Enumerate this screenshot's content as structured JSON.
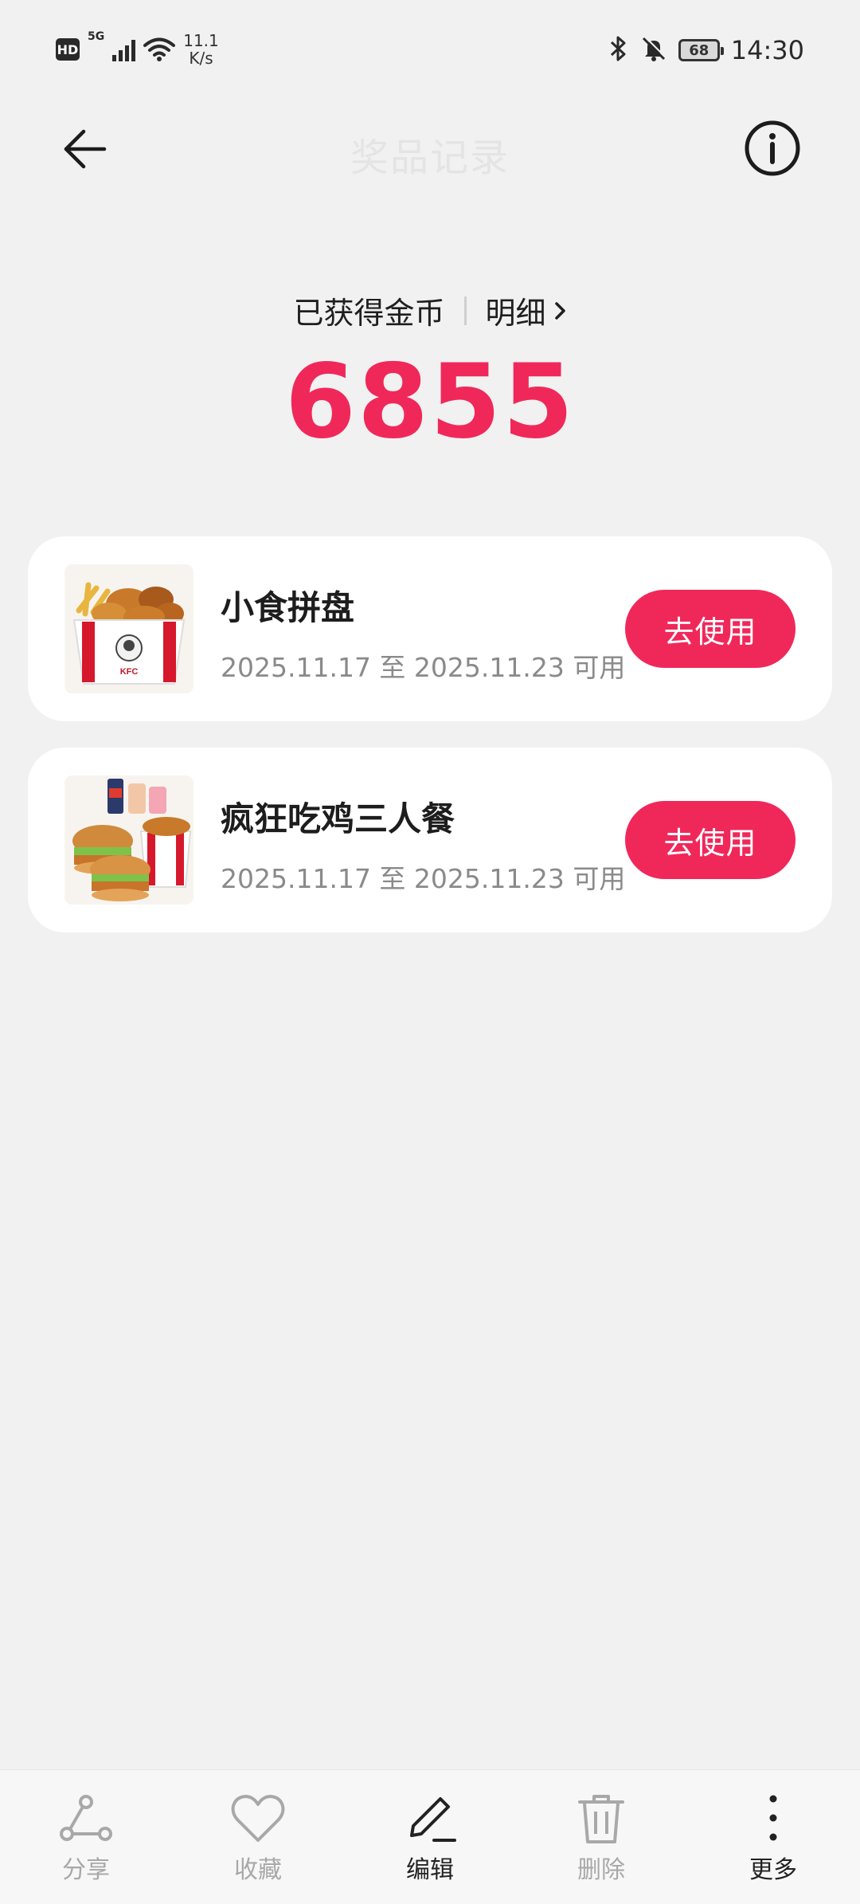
{
  "status_bar": {
    "hd": "HD",
    "network": "5G",
    "speed_value": "11.1",
    "speed_unit": "K/s",
    "battery": "68",
    "time": "14:30"
  },
  "header": {
    "title": "奖品记录",
    "back_icon": "arrow-left-icon",
    "info_icon": "info-circle-icon"
  },
  "coins": {
    "label": "已获得金币",
    "detail_label": "明细",
    "value": "6855"
  },
  "prizes": [
    {
      "title": "小食拼盘",
      "validity": "2025.11.17 至 2025.11.23 可用",
      "button": "去使用"
    },
    {
      "title": "疯狂吃鸡三人餐",
      "validity": "2025.11.17 至 2025.11.23 可用",
      "button": "去使用"
    }
  ],
  "bottom_bar": [
    {
      "label": "分享",
      "icon": "share-icon"
    },
    {
      "label": "收藏",
      "icon": "heart-icon"
    },
    {
      "label": "编辑",
      "icon": "pencil-icon"
    },
    {
      "label": "删除",
      "icon": "trash-icon"
    },
    {
      "label": "更多",
      "icon": "more-vertical-icon"
    }
  ],
  "colors": {
    "accent": "#f0285a",
    "background": "#f1f1f1",
    "card": "#ffffff"
  }
}
